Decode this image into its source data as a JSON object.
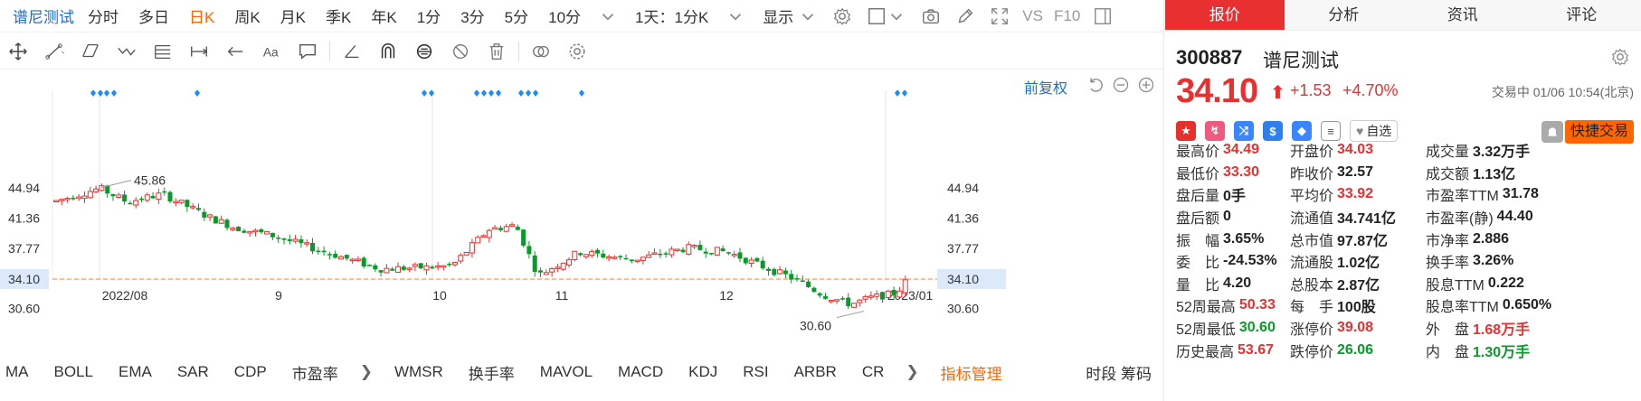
{
  "top_bar": {
    "stock_name": "谱尼测试",
    "periods": [
      "分时",
      "多日",
      "日K",
      "周K",
      "月K",
      "季K",
      "年K",
      "1分",
      "3分",
      "5分",
      "10分"
    ],
    "active_period": "日K",
    "interval_select": "1天：1分K",
    "display_label": "显示",
    "vs_label": "VS",
    "f10_label": "F10"
  },
  "chart": {
    "fuquan_label": "前复权",
    "y_ticks": [
      "44.94",
      "41.36",
      "37.77",
      "34.10",
      "30.60"
    ],
    "x_ticks": [
      "2022/08",
      "9",
      "10",
      "11",
      "12",
      "2023/01"
    ],
    "high_annotation": "45.86",
    "low_annotation": "30.60",
    "current_price_label": "34.10",
    "up_color": "#e93030",
    "down_color": "#0a9a2a",
    "marker_color": "#1a8cff"
  },
  "indicator_bar": {
    "items": [
      "MA",
      "BOLL",
      "EMA",
      "SAR",
      "CDP",
      "市盈率"
    ],
    "items2": [
      "WMSR",
      "换手率",
      "MAVOL",
      "MACD",
      "KDJ",
      "RSI",
      "ARBR",
      "CR"
    ],
    "manage_label": "指标管理",
    "right_label": "时段 筹码"
  },
  "quote": {
    "tabs": [
      "报价",
      "分析",
      "资讯",
      "评论"
    ],
    "active_tab": "报价",
    "code": "300887",
    "name": "谱尼测试",
    "price": "34.10",
    "change": "+1.53",
    "change_pct": "+4.70%",
    "status_time": "交易中 01/06 10:54(北京)",
    "zixuan_label": "自选",
    "trade_button": "快捷交易",
    "rows": [
      [
        [
          "最高价",
          "34.49",
          "red"
        ],
        [
          "开盘价",
          "34.03",
          "red"
        ],
        [
          "成交量",
          "3.32万手",
          ""
        ]
      ],
      [
        [
          "最低价",
          "33.30",
          "red"
        ],
        [
          "昨收价",
          "32.57",
          ""
        ],
        [
          "成交额",
          "1.13亿",
          ""
        ]
      ],
      [
        [
          "盘后量",
          "0手",
          ""
        ],
        [
          "平均价",
          "33.92",
          "red"
        ],
        [
          "市盈率TTM",
          "31.78",
          ""
        ]
      ],
      [
        [
          "盘后额",
          "0",
          ""
        ],
        [
          "流通值",
          "34.741亿",
          ""
        ],
        [
          "市盈率(静)",
          "44.40",
          ""
        ]
      ],
      [
        [
          "振　幅",
          "3.65%",
          ""
        ],
        [
          "总市值",
          "97.87亿",
          ""
        ],
        [
          "市净率",
          "2.886",
          ""
        ]
      ],
      [
        [
          "委　比",
          "-24.53%",
          ""
        ],
        [
          "流通股",
          "1.02亿",
          ""
        ],
        [
          "换手率",
          "3.26%",
          ""
        ]
      ],
      [
        [
          "量　比",
          "4.20",
          ""
        ],
        [
          "总股本",
          "2.87亿",
          ""
        ],
        [
          "股息TTM",
          "0.222",
          ""
        ]
      ],
      [
        [
          "52周最高",
          "50.33",
          "red"
        ],
        [
          "每　手",
          "100股",
          ""
        ],
        [
          "股息率TTM",
          "0.650%",
          ""
        ]
      ],
      [
        [
          "52周最低",
          "30.60",
          "green"
        ],
        [
          "涨停价",
          "39.08",
          "red"
        ],
        [
          "外　盘",
          "1.68万手",
          "red"
        ]
      ],
      [
        [
          "历史最高",
          "53.67",
          "red"
        ],
        [
          "跌停价",
          "26.06",
          "green"
        ],
        [
          "内　盘",
          "1.30万手",
          "green"
        ]
      ]
    ]
  }
}
